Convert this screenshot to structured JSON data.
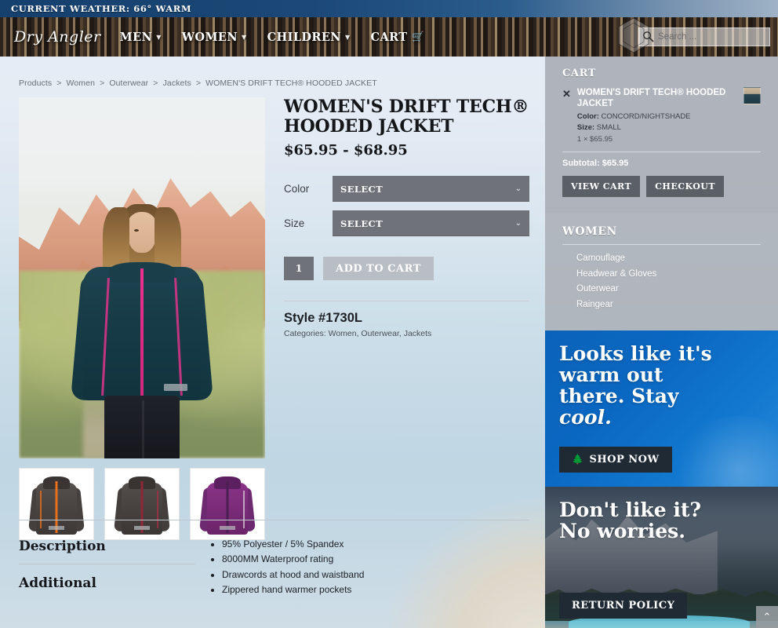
{
  "weather": {
    "text": "CURRENT WEATHER: 66° WARM"
  },
  "nav": {
    "logo": "Dry Angler",
    "items": [
      {
        "label": "MEN",
        "caret": true
      },
      {
        "label": "WOMEN",
        "caret": true
      },
      {
        "label": "CHILDREN",
        "caret": true
      },
      {
        "label": "CART",
        "caret": false,
        "icon": "cart-icon"
      }
    ],
    "search_placeholder": "Search ...",
    "search_value": "",
    "search_icon": "magnifier-icon",
    "badge_icon": "hex-badge-watermark"
  },
  "breadcrumb": {
    "items": [
      "Products",
      "Women",
      "Outerwear",
      "Jackets"
    ],
    "current": "WOMEN'S DRIFT TECH® HOODED JACKET",
    "separator": ">"
  },
  "product": {
    "title": "WOMEN'S DRIFT TECH® HOODED JACKET",
    "price": "$65.95 - $68.95",
    "color_label": "Color",
    "size_label": "Size",
    "color_value": "SELECT",
    "size_value": "SELECT",
    "quantity": "1",
    "add_to_cart": "ADD TO CART",
    "style": "Style #1730L",
    "categories": "Categories: Women, Outerwear, Jackets",
    "main_image_alt": "Woman wearing teal Drift Tech hooded jacket at red rocks",
    "thumbs": [
      {
        "alt": "Gray jacket with orange zipper",
        "body": "#4b4543",
        "zip": "#e8701b",
        "side": "#e8701b"
      },
      {
        "alt": "Gray jacket with red zipper",
        "body": "#4a4442",
        "zip": "#8e2738",
        "side": "#a33044"
      },
      {
        "alt": "Purple jacket",
        "body": "#7c2d7a",
        "zip": "#4c1f52",
        "side": "#c9bcc9"
      }
    ]
  },
  "description": {
    "tab_description": "Description",
    "tab_additional": "Additional",
    "bullets": [
      "95% Polyester / 5% Spandex",
      "8000MM Waterproof rating",
      "Drawcords at hood and waistband",
      "Zippered hand warmer pockets"
    ]
  },
  "cart_panel": {
    "heading": "CART",
    "remove_icon": "close-x-icon",
    "item_name": "WOMEN'S DRIFT TECH® HOODED JACKET",
    "color_key": "Color:",
    "color_value": "CONCORD/NIGHTSHADE",
    "size_key": "Size:",
    "size_value": "SMALL",
    "qty_price": "1 × $65.95",
    "subtotal": "Subtotal: $65.95",
    "view_cart": "VIEW CART",
    "checkout": "CHECKOUT"
  },
  "category_panel": {
    "heading": "WOMEN",
    "items": [
      "Camouflage",
      "Headwear & Gloves",
      "Outerwear",
      "Raingear"
    ]
  },
  "banner_warm": {
    "line1": "Looks like it's",
    "line2": "warm out",
    "line3": "there. Stay",
    "line4": "cool.",
    "button": "SHOP NOW",
    "button_icon": "pine-tree-icon",
    "accent": "#0a67c1"
  },
  "banner_return": {
    "line1": "Don't like it?",
    "line2": "No worries.",
    "button": "RETURN POLICY"
  },
  "scroll_top": {
    "icon": "chevron-up-icon"
  }
}
